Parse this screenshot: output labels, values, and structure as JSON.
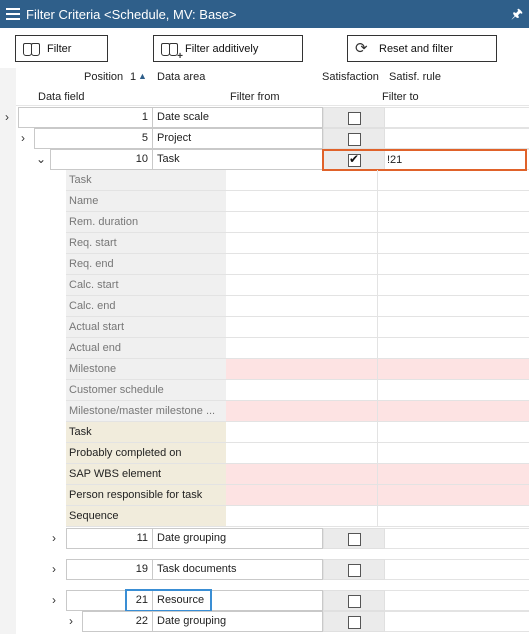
{
  "window": {
    "title": "Filter Criteria <Schedule, MV: Base>"
  },
  "toolbar": {
    "filter_label": "Filter",
    "filter_add_label": "Filter additively",
    "reset_label": "Reset and filter"
  },
  "headers": {
    "position": "Position",
    "sort_order": "1",
    "data_area": "Data area",
    "satisfaction": "Satisfaction",
    "satisf_rule": "Satisf. rule",
    "data_field": "Data field",
    "filter_from": "Filter from",
    "filter_to": "Filter to"
  },
  "rows": [
    {
      "pos": "1",
      "area": "Date scale",
      "checked": false,
      "rule": ""
    },
    {
      "pos": "5",
      "area": "Project",
      "checked": false,
      "rule": ""
    },
    {
      "pos": "10",
      "area": "Task",
      "checked": true,
      "rule": "!21"
    }
  ],
  "fields": [
    {
      "label": "Task",
      "style": "grey"
    },
    {
      "label": "Name",
      "style": "grey"
    },
    {
      "label": "Rem. duration",
      "style": "grey"
    },
    {
      "label": "Req. start",
      "style": "grey"
    },
    {
      "label": "Req. end",
      "style": "grey"
    },
    {
      "label": "Calc. start",
      "style": "grey"
    },
    {
      "label": "Calc. end",
      "style": "grey"
    },
    {
      "label": "Actual start",
      "style": "grey"
    },
    {
      "label": "Actual end",
      "style": "grey"
    },
    {
      "label": "Milestone",
      "style": "grey pink"
    },
    {
      "label": "Customer schedule",
      "style": "grey"
    },
    {
      "label": "Milestone/master milestone ...",
      "style": "grey pink"
    },
    {
      "label": "Task",
      "style": "tan"
    },
    {
      "label": "Probably completed on",
      "style": "tan"
    },
    {
      "label": "SAP WBS element",
      "style": "tan pink"
    },
    {
      "label": "Person responsible for task",
      "style": "tan pink"
    },
    {
      "label": "Sequence",
      "style": "tan"
    }
  ],
  "subrows": [
    {
      "pos": "11",
      "area": "Date grouping",
      "checked": false
    },
    {
      "pos": "19",
      "area": "Task documents",
      "checked": false
    },
    {
      "pos": "21",
      "area": "Resource",
      "checked": false
    },
    {
      "pos": "22",
      "area": "Date grouping",
      "checked": false
    }
  ],
  "icons": {
    "menu": "hamburger-icon",
    "pin": "pin-icon",
    "expand": "chevron-right-icon",
    "collapse": "chevron-down-icon",
    "sort": "sort-ascending-icon",
    "filter": "binoculars-icon",
    "filter_add": "binoculars-plus-icon",
    "reset": "refresh-icon"
  },
  "colors": {
    "titlebar": "#2f5f8a",
    "highlight_orange": "#e0622a",
    "highlight_blue": "#3a8ed4",
    "required_field": "#fde3e3",
    "tan_field": "#f1ecdc"
  }
}
